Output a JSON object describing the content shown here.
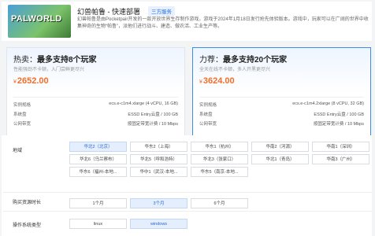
{
  "app": {
    "logo_text": "PALWORLD",
    "title": "幻兽帕鲁 - 快速部署",
    "badge": "三方服务",
    "description": "幻兽帕鲁是由Pocketpair开发的一款开放世界生存制作游戏，游戏于2024年1月18日发行抢先体验版本。游戏中，玩家可以在广阔的世界中收集神奇的生物“帕鲁”，派他们进行战斗、建造、做农活、工业生产等。"
  },
  "plans": [
    {
      "title_prefix": "热卖：",
      "title": "最多支持8个玩家",
      "subtitle": "性能强劲不卡顿，入门尝鲜更尽兴",
      "currency": "¥",
      "price": "2652.00",
      "specs": [
        {
          "key": "实例规格",
          "value": "ecs.e-c1m4.xlarge (4 vCPU, 16 GB)"
        },
        {
          "key": "系统盘",
          "value": "ESSD Entry云盘 / 100 GB"
        },
        {
          "key": "公网带宽",
          "value": "按固定带宽计费 / 10 Mbps"
        }
      ]
    },
    {
      "title_prefix": "力荐：",
      "title": "最多支持20个玩家",
      "subtitle": "全天在线不卡顿，多人开黑更尽兴",
      "currency": "¥",
      "price": "3624.00",
      "specs": [
        {
          "key": "实例规格",
          "value": "ecs.e-c1m4.2xlarge (8 vCPU, 32 GB)"
        },
        {
          "key": "系统盘",
          "value": "ESSD Entry云盘 / 100 GB"
        },
        {
          "key": "公网带宽",
          "value": "按固定带宽计费 / 10 Mbps"
        }
      ]
    }
  ],
  "config": {
    "region_label": "地域",
    "regions": [
      "华北2（北京）",
      "华东2（上海）",
      "华东1（杭州）",
      "华南2（河源）",
      "华南1（深圳）",
      "华北6（乌兰察布）",
      "华北5（呼和浩特）",
      "华北3（张家口）",
      "华北1（青岛）",
      "华南3（广州）",
      "华东6（福州-本地...",
      "华中1（武汉-本地...",
      "华东5（南京-本地..."
    ],
    "region_selected": 0,
    "duration_label": "购买资源时长",
    "durations": [
      "1个月",
      "3个月",
      "6个月"
    ],
    "duration_selected": 1,
    "os_label": "操作系统类型",
    "os_options": [
      "linux",
      "windows"
    ],
    "os_selected": 1
  }
}
